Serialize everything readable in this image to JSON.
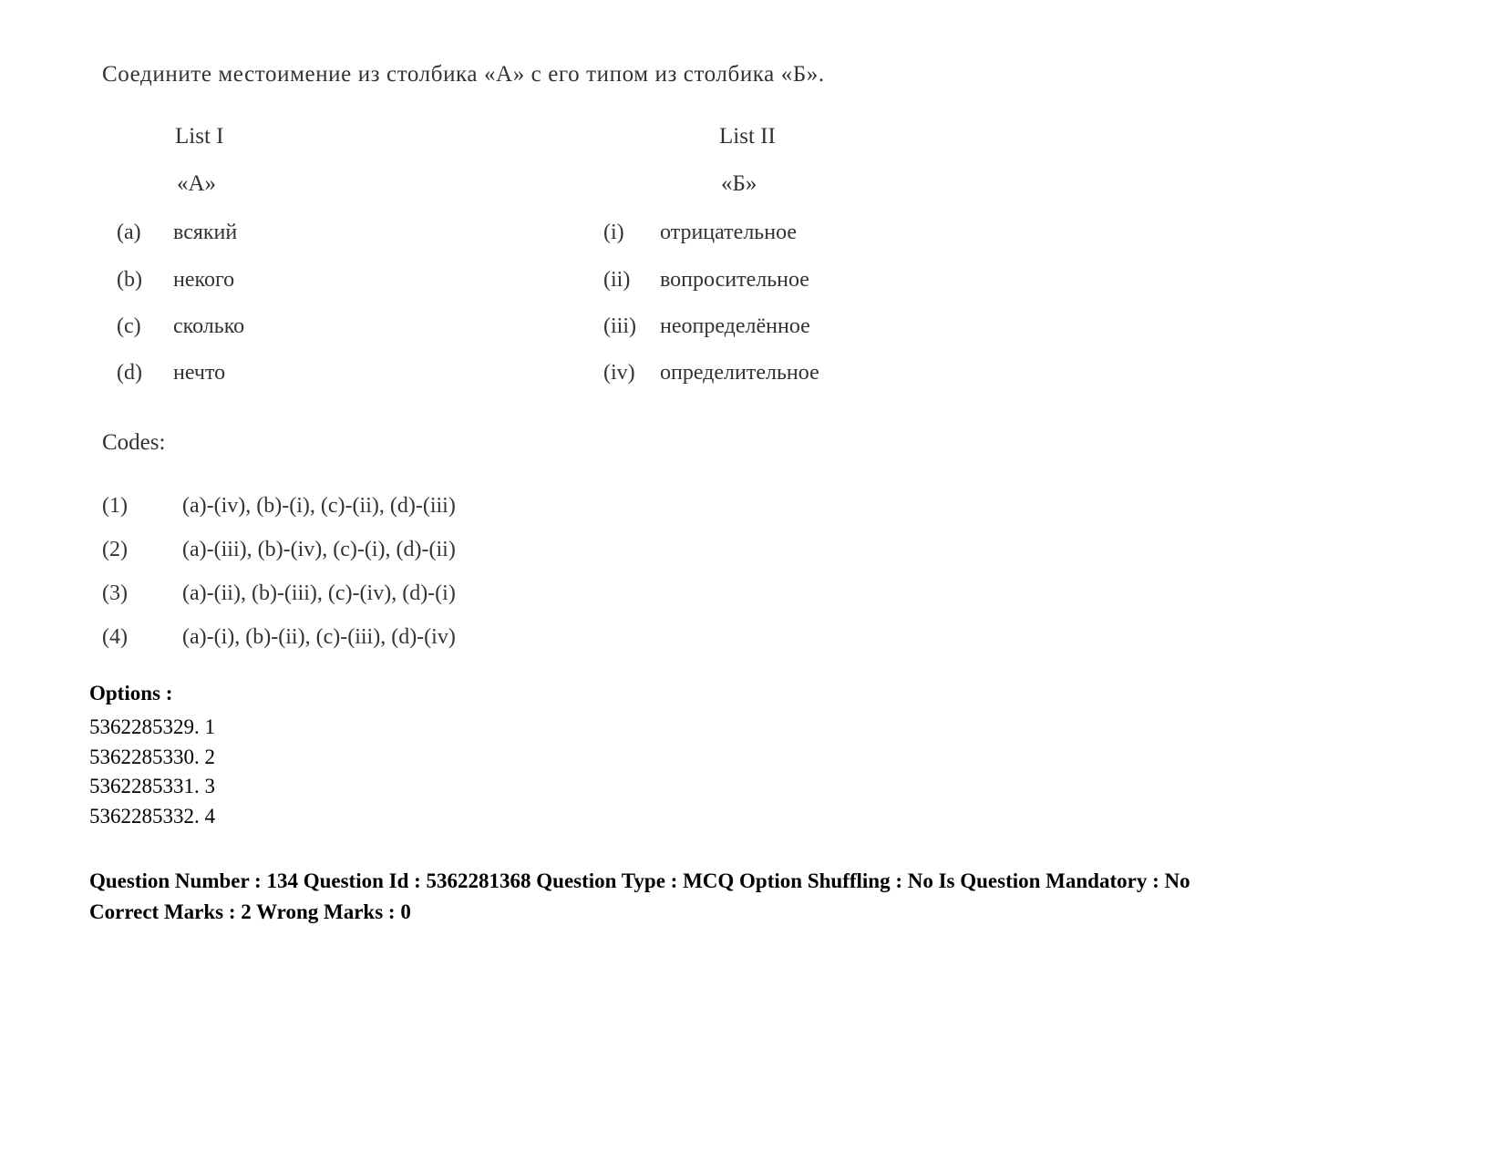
{
  "question": {
    "prompt": "Соедините местоимение из столбика «А» с его типом из столбика «Б».",
    "list_one": {
      "heading": "List I",
      "subheading": "«А»",
      "items": [
        {
          "mark": "(a)",
          "text": "всякий"
        },
        {
          "mark": "(b)",
          "text": "некого"
        },
        {
          "mark": "(c)",
          "text": "сколько"
        },
        {
          "mark": "(d)",
          "text": "нечто"
        }
      ]
    },
    "list_two": {
      "heading": "List II",
      "subheading": "«Б»",
      "items": [
        {
          "mark": "(i)",
          "text": "отрицательное"
        },
        {
          "mark": "(ii)",
          "text": "вопросительное"
        },
        {
          "mark": "(iii)",
          "text": "неопределённое"
        },
        {
          "mark": "(iv)",
          "text": "определительное"
        }
      ]
    },
    "codes_label": "Codes:",
    "codes": [
      {
        "num": "(1)",
        "text": "(a)-(iv), (b)-(i), (c)-(ii), (d)-(iii)"
      },
      {
        "num": "(2)",
        "text": "(a)-(iii), (b)-(iv), (c)-(i), (d)-(ii)"
      },
      {
        "num": "(3)",
        "text": "(a)-(ii), (b)-(iii), (c)-(iv), (d)-(i)"
      },
      {
        "num": "(4)",
        "text": "(a)-(i), (b)-(ii), (c)-(iii), (d)-(iv)"
      }
    ]
  },
  "options": {
    "title": "Options :",
    "items": [
      "5362285329. 1",
      "5362285330. 2",
      "5362285331. 3",
      "5362285332. 4"
    ]
  },
  "metadata": {
    "line1": "Question Number : 134 Question Id : 5362281368 Question Type : MCQ Option Shuffling : No Is Question Mandatory : No",
    "line2": "Correct Marks : 2 Wrong Marks : 0"
  }
}
